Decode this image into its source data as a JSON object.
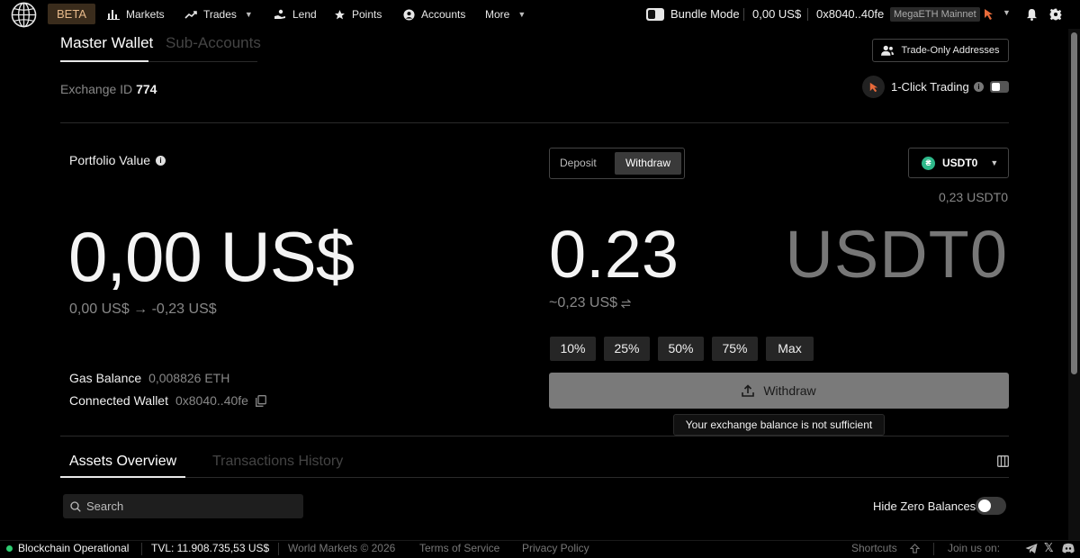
{
  "nav": {
    "beta": "BETA",
    "markets": "Markets",
    "trades": "Trades",
    "lend": "Lend",
    "points": "Points",
    "accounts": "Accounts",
    "more": "More",
    "bundle_mode": "Bundle Mode",
    "balance": "0,00 US$",
    "address": "0x8040..40fe",
    "network": "MegaETH Mainnet"
  },
  "wallet_tabs": {
    "master": "Master Wallet",
    "sub": "Sub-Accounts"
  },
  "trade_only": "Trade-Only Addresses",
  "exchange": {
    "label": "Exchange ID",
    "id": "774"
  },
  "one_click": "1-Click Trading",
  "portfolio": {
    "label": "Portfolio Value",
    "value": "0,00 US$",
    "change": "0,00 US$ → -0,23 US$",
    "gas_label": "Gas Balance",
    "gas_value": "0,008826 ETH",
    "wallet_label": "Connected Wallet",
    "wallet_value": "0x8040..40fe"
  },
  "transfer": {
    "deposit": "Deposit",
    "withdraw": "Withdraw",
    "token": "USDT0",
    "token_balance": "0,23 USDT0",
    "amount": "0.23",
    "amount_unit": "USDT0",
    "amount_fiat": "~0,23 US$",
    "percents": [
      "10%",
      "25%",
      "50%",
      "75%",
      "Max"
    ],
    "submit": "Withdraw",
    "error": "Your exchange balance is not sufficient"
  },
  "assets": {
    "tab_overview": "Assets Overview",
    "tab_history": "Transactions History",
    "search_placeholder": "Search",
    "hide_zero": "Hide Zero Balances"
  },
  "footer": {
    "status": "Blockchain Operational",
    "tvl": "TVL: 11.908.735,53 US$",
    "copyright": "World Markets © 2026",
    "terms": "Terms of Service",
    "privacy": "Privacy Policy",
    "shortcuts": "Shortcuts",
    "join": "Join us on:"
  },
  "colors": {
    "accent_green": "#2ecc71",
    "token_green": "#2eb88a",
    "beta_bg": "#3a2c1c"
  }
}
